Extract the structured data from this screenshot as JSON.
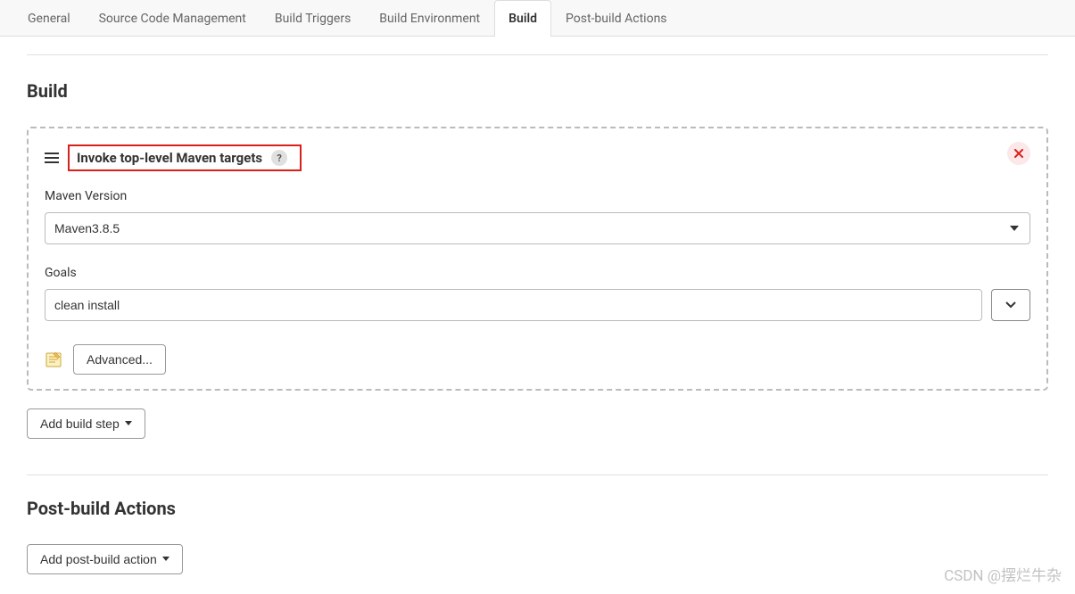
{
  "tabs": [
    {
      "label": "General"
    },
    {
      "label": "Source Code Management"
    },
    {
      "label": "Build Triggers"
    },
    {
      "label": "Build Environment"
    },
    {
      "label": "Build",
      "active": true
    },
    {
      "label": "Post-build Actions"
    }
  ],
  "build": {
    "section_title": "Build",
    "step_title": "Invoke top-level Maven targets",
    "help_char": "?",
    "maven_version_label": "Maven Version",
    "maven_version_value": "Maven3.8.5",
    "goals_label": "Goals",
    "goals_value": "clean install",
    "advanced_label": "Advanced...",
    "add_step_label": "Add build step"
  },
  "post_build": {
    "section_title": "Post-build Actions",
    "add_action_label": "Add post-build action"
  },
  "watermark": "CSDN @摆烂牛杂"
}
